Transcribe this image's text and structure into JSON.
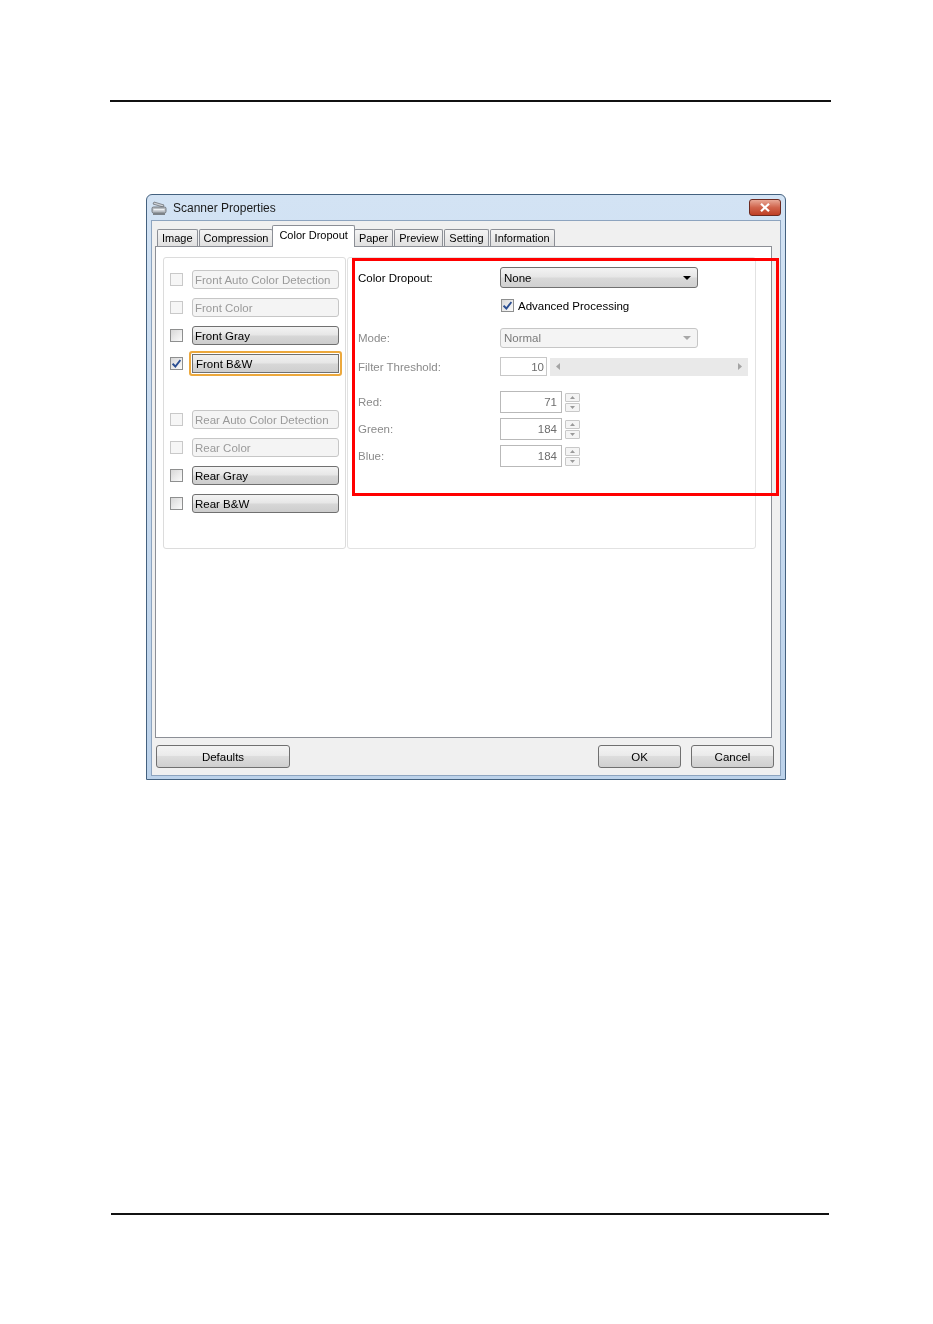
{
  "window": {
    "title": "Scanner Properties"
  },
  "tabs": [
    {
      "label": "Image",
      "selected": false
    },
    {
      "label": "Compression",
      "selected": false
    },
    {
      "label": "Color Dropout",
      "selected": true
    },
    {
      "label": "Paper",
      "selected": false
    },
    {
      "label": "Preview",
      "selected": false
    },
    {
      "label": "Setting",
      "selected": false
    },
    {
      "label": "Information",
      "selected": false
    }
  ],
  "front_options": [
    {
      "label": "Front Auto Color Detection",
      "checked": false,
      "disabled": true,
      "focused": false
    },
    {
      "label": "Front Color",
      "checked": false,
      "disabled": true,
      "focused": false
    },
    {
      "label": "Front Gray",
      "checked": false,
      "disabled": false,
      "focused": false
    },
    {
      "label": "Front B&W",
      "checked": true,
      "disabled": false,
      "focused": true
    }
  ],
  "rear_options": [
    {
      "label": "Rear Auto Color Detection",
      "checked": false,
      "disabled": true,
      "focused": false
    },
    {
      "label": "Rear Color",
      "checked": false,
      "disabled": true,
      "focused": false
    },
    {
      "label": "Rear Gray",
      "checked": false,
      "disabled": false,
      "focused": false
    },
    {
      "label": "Rear B&W",
      "checked": false,
      "disabled": false,
      "focused": false
    }
  ],
  "color_dropout": {
    "label": "Color Dropout:",
    "value": "None",
    "disabled": false
  },
  "advanced_processing": {
    "label": "Advanced Processing",
    "checked": true
  },
  "mode": {
    "label": "Mode:",
    "value": "Normal",
    "disabled": true
  },
  "filter_threshold": {
    "label": "Filter Threshold:",
    "value": "10",
    "disabled": true
  },
  "channels": [
    {
      "label": "Red:",
      "value": "71",
      "disabled": true
    },
    {
      "label": "Green:",
      "value": "184",
      "disabled": true
    },
    {
      "label": "Blue:",
      "value": "184",
      "disabled": true
    }
  ],
  "buttons_left": [
    "Defaults"
  ],
  "buttons_right": [
    "OK",
    "Cancel"
  ],
  "annotations": [
    {
      "kind": "frame"
    }
  ]
}
